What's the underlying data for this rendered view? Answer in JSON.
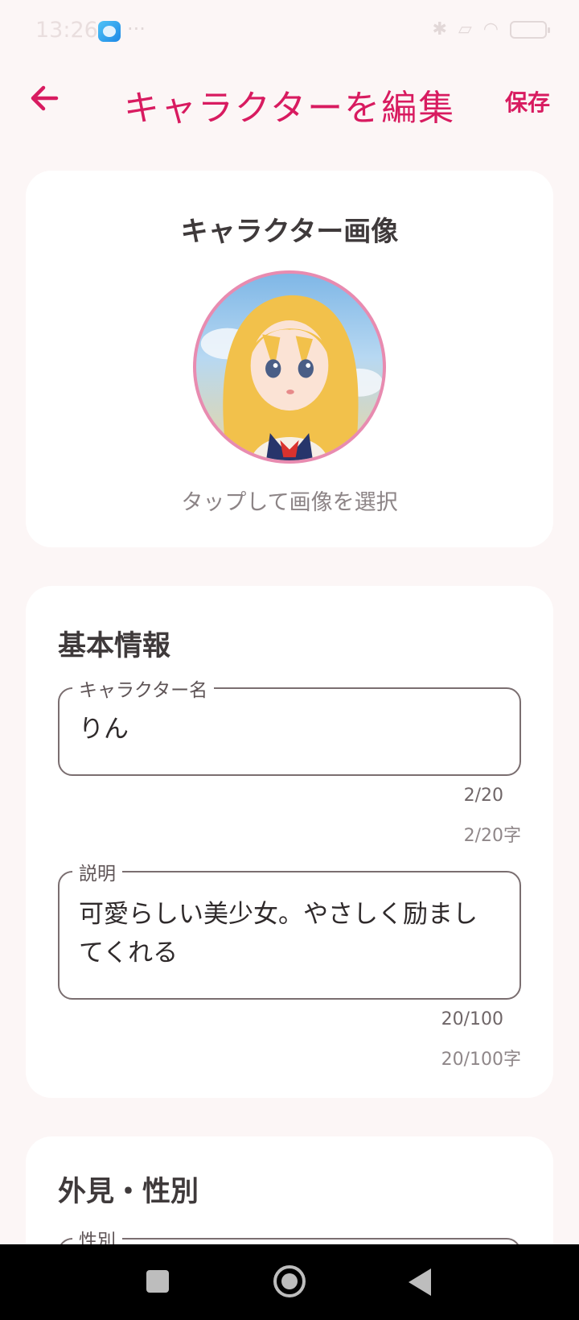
{
  "status_bar": {
    "time": "13:26",
    "dots": "···"
  },
  "app_bar": {
    "title": "キャラクターを編集",
    "save_label": "保存"
  },
  "image_card": {
    "title": "キャラクター画像",
    "hint": "タップして画像を選択"
  },
  "basic_info": {
    "title": "基本情報",
    "name_field": {
      "label": "キャラクター名",
      "value": "りん",
      "counter": "2/20",
      "counter_chars": "2/20字"
    },
    "desc_field": {
      "label": "説明",
      "value": "可愛らしい美少女。やさしく励ましてくれる",
      "counter": "20/100",
      "counter_chars": "20/100字"
    }
  },
  "appearance": {
    "title": "外見・性別",
    "gender_field": {
      "label": "性別"
    }
  },
  "colors": {
    "accent": "#d81b60",
    "avatar_border": "#e88bb0",
    "background": "#fcf6f6"
  }
}
